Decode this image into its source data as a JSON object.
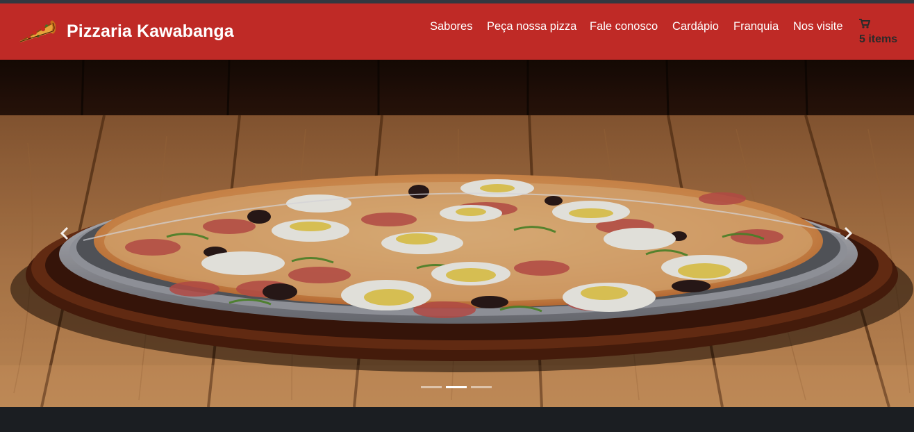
{
  "brand": {
    "title": "Pizzaria Kawabanga",
    "logo_icon": "pizza-slice-icon",
    "bar_color": "#bf2a26"
  },
  "nav": {
    "items": [
      {
        "label": "Sabores"
      },
      {
        "label": "Peça nossa pizza"
      },
      {
        "label": "Fale conosco"
      },
      {
        "label": "Cardápio"
      },
      {
        "label": "Franquia"
      },
      {
        "label": "Nos visite"
      }
    ]
  },
  "cart": {
    "icon": "cart-icon",
    "count_label": "5 items"
  },
  "carousel": {
    "slide_image": "pizza-on-wooden-table-photo",
    "slide_count": 3,
    "active_slide": 2,
    "prev_icon": "chevron-left-icon",
    "next_icon": "chevron-right-icon"
  }
}
